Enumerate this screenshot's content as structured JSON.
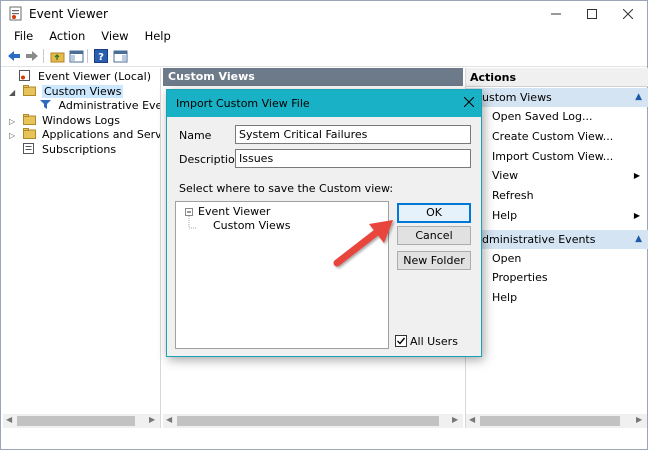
{
  "window": {
    "title": "Event Viewer"
  },
  "menu": [
    "File",
    "Action",
    "View",
    "Help"
  ],
  "tree": {
    "items": [
      {
        "label": "Event Viewer (Local)"
      },
      {
        "label": "Custom Views"
      },
      {
        "label": "Administrative Events"
      },
      {
        "label": "Windows Logs"
      },
      {
        "label": "Applications and Services Lo"
      },
      {
        "label": "Subscriptions"
      }
    ]
  },
  "middle": {
    "header": "Custom Views"
  },
  "actions": {
    "title": "Actions",
    "section1": "ustom Views",
    "items1": [
      "Open Saved Log...",
      "Create Custom View...",
      "Import Custom View...",
      "View",
      "Refresh",
      "Help"
    ],
    "section2": "dministrative Events",
    "items2": [
      "Open",
      "Properties",
      "Help"
    ]
  },
  "dialog": {
    "title": "Import Custom View File",
    "name_label": "Name",
    "name_value": "System Critical Failures",
    "description_label": "Description",
    "description_value": "Issues",
    "save_label": "Select where to save the Custom view:",
    "tree_root": "Event Viewer",
    "tree_child": "Custom Views",
    "ok": "OK",
    "cancel": "Cancel",
    "new_folder": "New Folder",
    "all_users": "All Users",
    "all_users_checked": true
  },
  "colors": {
    "dialog_title_bar": "#18b1c5",
    "ok_focus_border": "#0078d7",
    "pane_header": "#6d7a8a",
    "action_section": "#d5e4f3",
    "selection": "#cce8ff",
    "arrow": "#e8453c"
  }
}
